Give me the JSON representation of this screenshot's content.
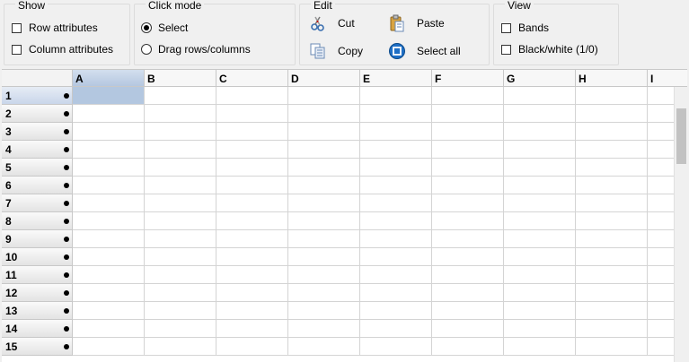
{
  "show": {
    "title": "Show",
    "row_attributes": "Row attributes",
    "column_attributes": "Column attributes"
  },
  "click_mode": {
    "title": "Click mode",
    "select": "Select",
    "drag": "Drag rows/columns"
  },
  "edit": {
    "title": "Edit",
    "cut": "Cut",
    "copy": "Copy",
    "paste": "Paste",
    "select_all": "Select all"
  },
  "view": {
    "title": "View",
    "bands": "Bands",
    "black_white": "Black/white (1/0)"
  },
  "grid": {
    "columns": [
      "A",
      "B",
      "C",
      "D",
      "E",
      "F",
      "G",
      "H",
      "I"
    ],
    "rows": [
      "1",
      "2",
      "3",
      "4",
      "5",
      "6",
      "7",
      "8",
      "9",
      "10",
      "11",
      "12",
      "13",
      "14",
      "15"
    ],
    "selected_cell": "A1"
  },
  "colors": {
    "selection": "#b3c7e0",
    "grid_line": "#d4d4d4"
  }
}
